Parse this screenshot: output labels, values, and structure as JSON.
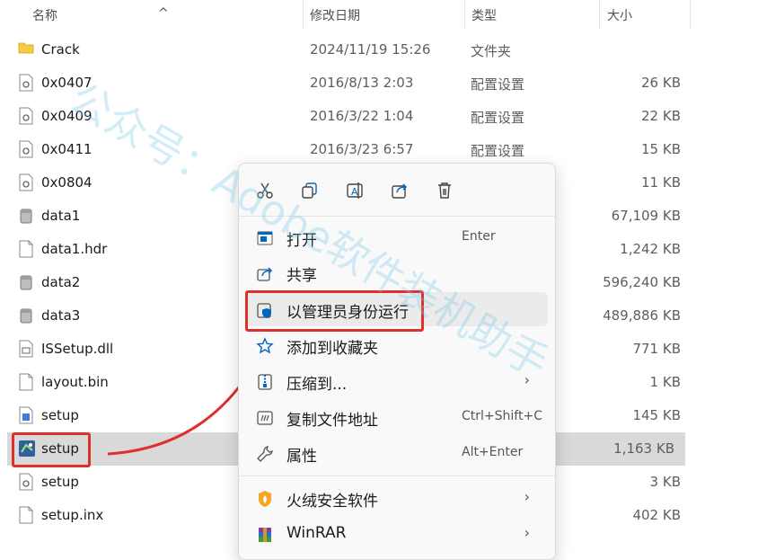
{
  "header": {
    "name": "名称",
    "date": "修改日期",
    "type": "类型",
    "size": "大小",
    "sort_arrow": "^"
  },
  "files": [
    {
      "name": "Crack",
      "date": "2024/11/19 15:26",
      "type": "文件夹",
      "size": "",
      "icon": "folder-icon"
    },
    {
      "name": "0x0407",
      "date": "2016/8/13 2:03",
      "type": "配置设置",
      "size": "26 KB",
      "icon": "config-file-icon"
    },
    {
      "name": "0x0409",
      "date": "2016/3/22 1:04",
      "type": "配置设置",
      "size": "22 KB",
      "icon": "config-file-icon"
    },
    {
      "name": "0x0411",
      "date": "2016/3/23 6:57",
      "type": "配置设置",
      "size": "15 KB",
      "icon": "config-file-icon"
    },
    {
      "name": "0x0804",
      "date": "",
      "type": "",
      "size": "11 KB",
      "icon": "config-file-icon"
    },
    {
      "name": "data1",
      "date": "",
      "type": "",
      "size": "67,109 KB",
      "icon": "cabinet-file-icon"
    },
    {
      "name": "data1.hdr",
      "date": "",
      "type": "",
      "size": "1,242 KB",
      "icon": "file-icon"
    },
    {
      "name": "data2",
      "date": "",
      "type": "",
      "size": "596,240 KB",
      "icon": "cabinet-file-icon"
    },
    {
      "name": "data3",
      "date": "",
      "type": "",
      "size": "489,886 KB",
      "icon": "cabinet-file-icon"
    },
    {
      "name": "ISSetup.dll",
      "date": "",
      "type": "",
      "size": "771 KB",
      "icon": "dll-file-icon"
    },
    {
      "name": "layout.bin",
      "date": "",
      "type": "",
      "size": "1 KB",
      "icon": "file-icon"
    },
    {
      "name": "setup",
      "date": "",
      "type": "",
      "size": "145 KB",
      "icon": "settings-file-icon"
    },
    {
      "name": "setup",
      "date": "",
      "type": "",
      "size": "1,163 KB",
      "icon": "installer-icon",
      "selected": true
    },
    {
      "name": "setup",
      "date": "",
      "type": "",
      "size": "3 KB",
      "icon": "config-file-icon"
    },
    {
      "name": "setup.inx",
      "date": "",
      "type": "",
      "size": "402 KB",
      "icon": "file-icon"
    }
  ],
  "context_menu": {
    "quick_actions": [
      "cut-icon",
      "copy-icon",
      "rename-icon",
      "share-icon",
      "delete-icon"
    ],
    "items": [
      {
        "label": "打开",
        "shortcut": "Enter",
        "icon": "open-icon"
      },
      {
        "label": "共享",
        "shortcut": "",
        "icon": "share-icon"
      },
      {
        "label": "以管理员身份运行",
        "shortcut": "",
        "icon": "admin-shield-icon",
        "highlighted": true
      },
      {
        "label": "添加到收藏夹",
        "shortcut": "",
        "icon": "star-icon"
      },
      {
        "label": "压缩到...",
        "shortcut": "",
        "icon": "zip-icon",
        "submenu": true
      },
      {
        "label": "复制文件地址",
        "shortcut": "Ctrl+Shift+C",
        "icon": "copy-path-icon"
      },
      {
        "label": "属性",
        "shortcut": "Alt+Enter",
        "icon": "wrench-icon"
      },
      {
        "label": "火绒安全软件",
        "shortcut": "",
        "icon": "huorong-icon",
        "submenu": true
      },
      {
        "label": "WinRAR",
        "shortcut": "",
        "icon": "winrar-icon",
        "submenu": true
      }
    ],
    "chevron": "›"
  },
  "watermark": "公众号：Adobe软件装机助手",
  "colors": {
    "highlight": "#e0302c",
    "accent": "#0067c0",
    "selection": "#d9d9d9"
  }
}
